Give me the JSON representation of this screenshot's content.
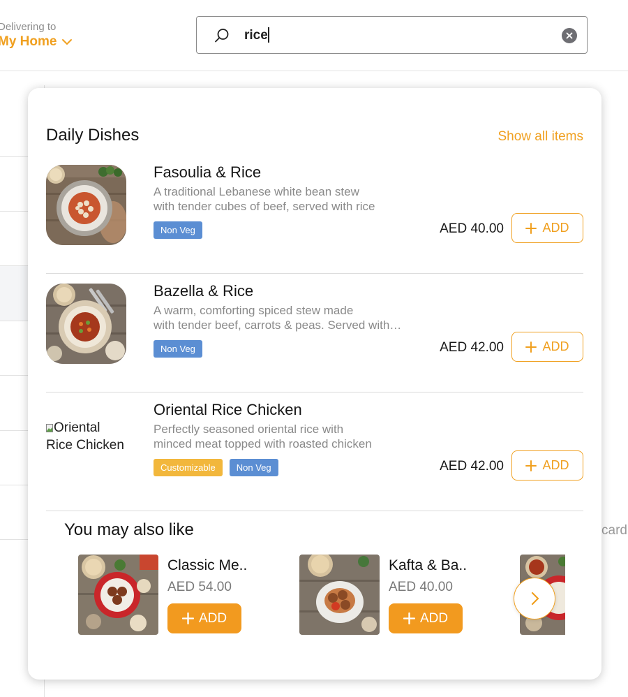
{
  "header": {
    "delivery_caption": "Delivering to",
    "delivery_location": "My Home"
  },
  "search": {
    "value": "rice",
    "placeholder": ""
  },
  "background": {
    "peek_text": "card"
  },
  "dropdown": {
    "section_title": "Daily Dishes",
    "show_all_label": "Show all items",
    "dishes": [
      {
        "name": "Fasoulia & Rice",
        "desc_line1": "A traditional Lebanese white bean stew",
        "desc_line2": "with tender cubes of beef, served with rice",
        "tags": [
          "Non Veg"
        ],
        "price": "AED 40.00",
        "add_label": "ADD",
        "image": "photo"
      },
      {
        "name": "Bazella & Rice",
        "desc_line1": "A warm, comforting spiced stew made",
        "desc_line2": "with tender beef, carrots & peas. Served with rice",
        "tags": [
          "Non Veg"
        ],
        "price": "AED 42.00",
        "add_label": "ADD",
        "image": "photo"
      },
      {
        "name": "Oriental Rice Chicken",
        "desc_line1": "Perfectly seasoned oriental rice with",
        "desc_line2": "minced meat topped with roasted chicken",
        "tags": [
          "Customizable",
          "Non Veg"
        ],
        "price": "AED 42.00",
        "add_label": "ADD",
        "image": "broken",
        "image_alt": "Oriental Rice Chicken"
      }
    ],
    "also_like_title": "You may also like",
    "suggestions": [
      {
        "name": "Classic Me..",
        "price": "AED 54.00",
        "add_label": "ADD"
      },
      {
        "name": "Kafta & Ba..",
        "price": "AED 40.00",
        "add_label": "ADD"
      }
    ]
  },
  "icons": {
    "search": "search-icon",
    "clear": "clear-icon",
    "chevron_down": "chevron-down-icon",
    "plus": "plus-icon",
    "chevron_right": "chevron-right-icon"
  },
  "colors": {
    "accent": "#f0a020",
    "accent_fill": "#f29a1f",
    "tag_non_veg": "#5b8ed3",
    "tag_customizable": "#f2b73c"
  }
}
